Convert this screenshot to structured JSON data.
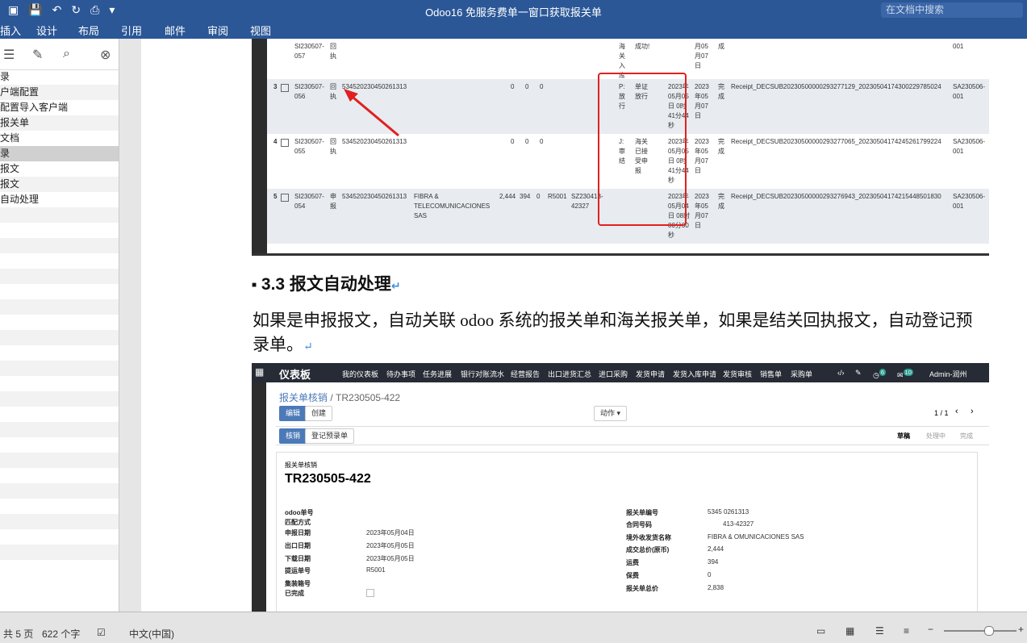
{
  "window": {
    "title": "Odoo16 免服务费单一窗口获取报关单",
    "search_placeholder": "在文档中搜索"
  },
  "ribbon": {
    "tabs": [
      "插入",
      "设计",
      "布局",
      "引用",
      "邮件",
      "审阅",
      "视图"
    ]
  },
  "nav_pane": {
    "items": [
      "录",
      "户端配置",
      "配置导入客户端",
      "报关单",
      "文档",
      "录",
      "报文",
      "报文",
      "自动处理"
    ]
  },
  "receipt_table": {
    "rows": [
      {
        "no": "",
        "sid": "SI230507-057",
        "type": "回执",
        "code": "",
        "a": "",
        "b": "",
        "c": "",
        "p": "",
        "cn": "",
        "st1": "海关入库",
        "st2": "成功!",
        "t1": "",
        "t2": "月05月07日",
        "done": "成",
        "file": "",
        "sa": "001"
      },
      {
        "no": "3",
        "sid": "SI230507-056",
        "type": "回执",
        "code": "534520230450261313",
        "a": "0",
        "b": "0",
        "c": "0",
        "p": "",
        "cn": "",
        "st1": "P: 放行",
        "st2": "单证放行",
        "t1": "2023年05月05日 0时41分44秒",
        "t2": "2023年05月07日",
        "done": "完成",
        "file": "Receipt_DECSUB20230500000293277129_20230504174300229785024",
        "sa": "SA230506-001"
      },
      {
        "no": "4",
        "sid": "SI230507-055",
        "type": "回执",
        "code": "534520230450261313",
        "a": "0",
        "b": "0",
        "c": "0",
        "p": "",
        "cn": "",
        "st1": "J: 审结",
        "st2": "海关已接受申报",
        "t1": "2023年05月05日 0时41分44秒",
        "t2": "2023年05月07日",
        "done": "完成",
        "file": "Receipt_DECSUB20230500000293277065_20230504174245261799224",
        "sa": "SA230506-001"
      },
      {
        "no": "5",
        "sid": "SI230507-054",
        "type": "申报",
        "code": "534520230450261313",
        "a": "2,444",
        "b": "394",
        "c": "0",
        "p": "R5001",
        "cn": "SZ230413-42327",
        "st1": "",
        "st2": "",
        "t1": "2023年05月04日 08时00分00秒",
        "t2": "2023年05月07日",
        "done": "完成",
        "file": "Receipt_DECSUB20230500000293276943_20230504174215448501830",
        "sa": "SA230506-001"
      }
    ],
    "company": "FIBRA & TELECOMUNICACIONES SAS"
  },
  "section": {
    "heading": "3.3 报文自动处理",
    "paragraph": "如果是申报报文，自动关联 odoo 系统的报关单和海关报关单，如果是结关回执报文，自动登记预录单。"
  },
  "odoo": {
    "app": "仪表板",
    "menu": [
      "我的仪表板",
      "待办事项",
      "任务进展",
      "银行对账流水",
      "经营报告",
      "出口进货汇总",
      "进口采购",
      "发货申请",
      "发货入库申请",
      "发货审核",
      "销售单",
      "采购单"
    ],
    "badges": {
      "activity": "6",
      "messages": "10"
    },
    "user": "Admin-润州",
    "breadcrumb_parent": "报关单核销",
    "breadcrumb_current": "TR230505-422",
    "buttons": {
      "edit": "编辑",
      "create": "创建",
      "action": "动作",
      "writeoff": "核销",
      "register": "登记预录单"
    },
    "pager": "1 / 1",
    "stages": [
      "草稿",
      "处理中",
      "完成"
    ],
    "record_type": "报关单核销",
    "record_name": "TR230505-422",
    "left_fields": [
      {
        "label": "odoo单号",
        "value": ""
      },
      {
        "label": "匹配方式",
        "value": ""
      },
      {
        "label": "申报日期",
        "value": "2023年05月04日"
      },
      {
        "label": "出口日期",
        "value": "2023年05月05日"
      },
      {
        "label": "下载日期",
        "value": "2023年05月05日"
      },
      {
        "label": "提运单号",
        "value": "R5001"
      },
      {
        "label": "集装箱号",
        "value": ""
      },
      {
        "label": "已完成",
        "value": ""
      }
    ],
    "right_fields": [
      {
        "label": "报关单编号",
        "value": "5345      0261313"
      },
      {
        "label": "合同号码",
        "value": "413-42327"
      },
      {
        "label": "境外收发货名称",
        "value": "FIBRA &      OMUNICACIONES SAS"
      },
      {
        "label": "成交总价(原币)",
        "value": "2,444"
      },
      {
        "label": "运费",
        "value": "394"
      },
      {
        "label": "保费",
        "value": "0"
      },
      {
        "label": "报关单总价",
        "value": "2,838"
      }
    ]
  },
  "statusbar": {
    "page": "共 5 页",
    "words": "622 个字",
    "lang": "中文(中国)"
  }
}
